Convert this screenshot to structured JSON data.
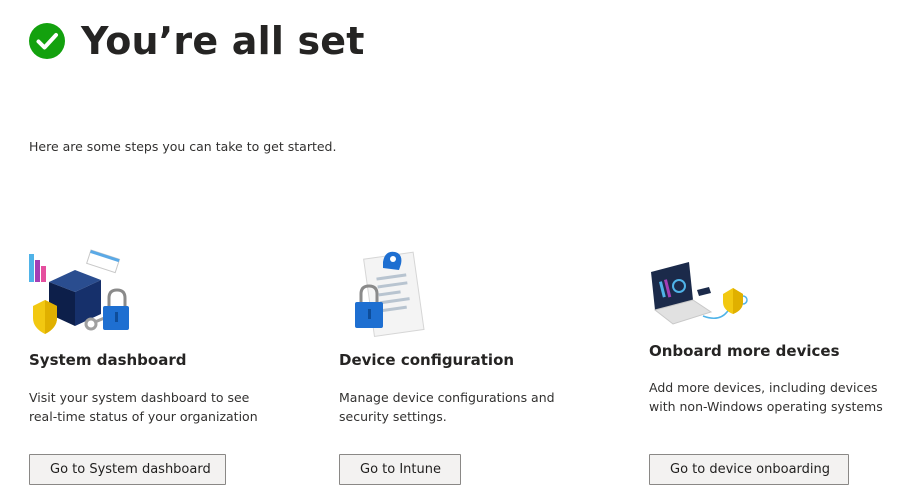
{
  "header": {
    "title": "You’re all set",
    "check_icon": "checkmark-circle-icon",
    "check_color": "#13a10e"
  },
  "intro": {
    "text": "Here are some steps you can take to get started."
  },
  "cards": [
    {
      "illustration": "system-dashboard-illustration",
      "title": "System dashboard",
      "description": "Visit your system dashboard to see real-time status of your organization",
      "button_label": "Go to System dashboard"
    },
    {
      "illustration": "device-configuration-illustration",
      "title": "Device configuration",
      "description": "Manage device configurations and security settings.",
      "button_label": "Go to Intune"
    },
    {
      "illustration": "onboard-devices-illustration",
      "title": "Onboard more devices",
      "description": "Add more devices, including devices with non-Windows operating systems",
      "button_label": "Go to device onboarding"
    }
  ],
  "colors": {
    "accent_blue": "#0f6cbd",
    "success_green": "#13a10e",
    "button_bg": "#f3f2f1",
    "button_border": "#8a8886",
    "text": "#323130"
  }
}
